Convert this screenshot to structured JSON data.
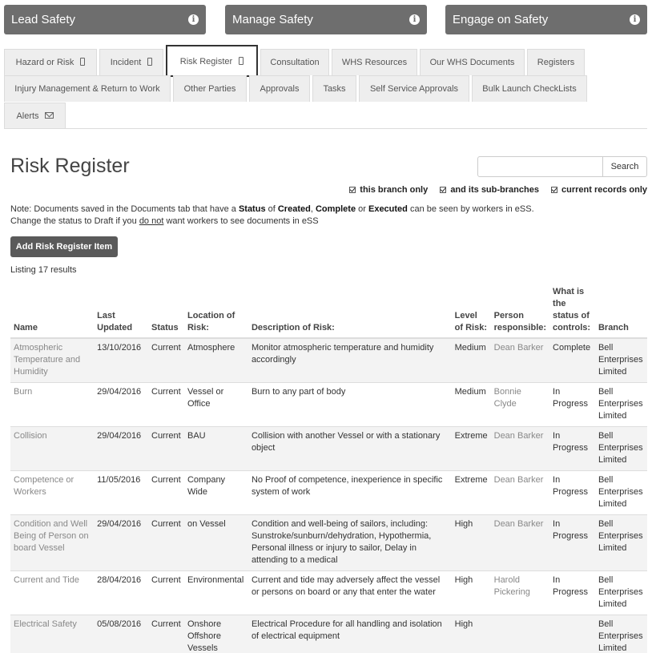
{
  "top_buttons": [
    {
      "label": "Lead Safety"
    },
    {
      "label": "Manage Safety"
    },
    {
      "label": "Engage on Safety"
    }
  ],
  "tabs_row1": [
    {
      "label": "Hazard or Risk"
    },
    {
      "label": "Incident"
    },
    {
      "label": "Risk Register"
    },
    {
      "label": "Consultation"
    },
    {
      "label": "WHS Resources"
    },
    {
      "label": "Our WHS Documents"
    },
    {
      "label": "Registers"
    }
  ],
  "tabs_row2": [
    {
      "label": "Injury Management & Return to Work"
    },
    {
      "label": "Other Parties"
    },
    {
      "label": "Approvals"
    },
    {
      "label": "Tasks"
    },
    {
      "label": "Self Service Approvals"
    },
    {
      "label": "Bulk Launch CheckLists"
    }
  ],
  "tabs_row3": [
    {
      "label": "Alerts"
    }
  ],
  "page": {
    "title": "Risk Register",
    "search_button": "Search",
    "search_value": "",
    "filters": [
      "this branch only",
      "and its sub-branches",
      "current records only"
    ],
    "note_line1_a": "Note:  Documents saved in the Documents tab that have a ",
    "note_status": "Status",
    "note_of": " of ",
    "note_created": "Created",
    "note_comma": ", ",
    "note_complete": "Complete",
    "note_or": " or ",
    "note_executed": "Executed",
    "note_line1_b": " can be seen by workers in eSS.",
    "note_line2_a": "Change the status to Draft if you ",
    "note_do_not": "do not",
    "note_line2_b": " want workers to see documents in eSS",
    "add_button": "Add Risk Register Item",
    "listing": "Listing 17 results"
  },
  "table": {
    "headers": [
      "Name",
      "Last Updated",
      "Status",
      "Location of Risk:",
      "Description of Risk:",
      "Level of Risk:",
      "Person responsible:",
      "What is the status of controls:",
      "Branch"
    ],
    "rows": [
      [
        "Atmospheric Temperature and Humidity",
        "13/10/2016",
        "Current",
        "Atmosphere",
        "Monitor atmospheric temperature and humidity accordingly",
        "Medium",
        "Dean Barker",
        "Complete",
        "Bell Enterprises Limited"
      ],
      [
        "Burn",
        "29/04/2016",
        "Current",
        "Vessel or Office",
        "Burn to any part of body",
        "Medium",
        "Bonnie Clyde",
        "In Progress",
        "Bell Enterprises Limited"
      ],
      [
        "Collision",
        "29/04/2016",
        "Current",
        "BAU",
        "Collision with another Vessel or with a stationary object",
        "Extreme",
        "Dean Barker",
        "In Progress",
        "Bell Enterprises Limited"
      ],
      [
        "Competence or Workers",
        "11/05/2016",
        "Current",
        "Company Wide",
        "No Proof of competence, inexperience in specific system of work",
        "Extreme",
        "Dean Barker",
        "In Progress",
        "Bell Enterprises Limited"
      ],
      [
        "Condition and Well Being of Person on board Vessel",
        "29/04/2016",
        "Current",
        "on Vessel",
        "Condition and well-being of sailors, including: Sunstroke/sunburn/dehydration, Hypothermia, Personal illness or injury to sailor, Delay in attending to a medical",
        "High",
        "Dean Barker",
        "In Progress",
        "Bell Enterprises Limited"
      ],
      [
        "Current and Tide",
        "28/04/2016",
        "Current",
        "Environmental",
        "Current and tide may adversely affect the vessel or persons on board or any that enter the water",
        "High",
        "Harold Pickering",
        "In Progress",
        "Bell Enterprises Limited"
      ],
      [
        "Electrical Safety",
        "05/08/2016",
        "Current",
        "Onshore Offshore Vessels",
        "Electrical Procedure for all handling and isolation of electrical equipment",
        "High",
        "",
        "",
        "Bell Enterprises Limited"
      ]
    ]
  }
}
